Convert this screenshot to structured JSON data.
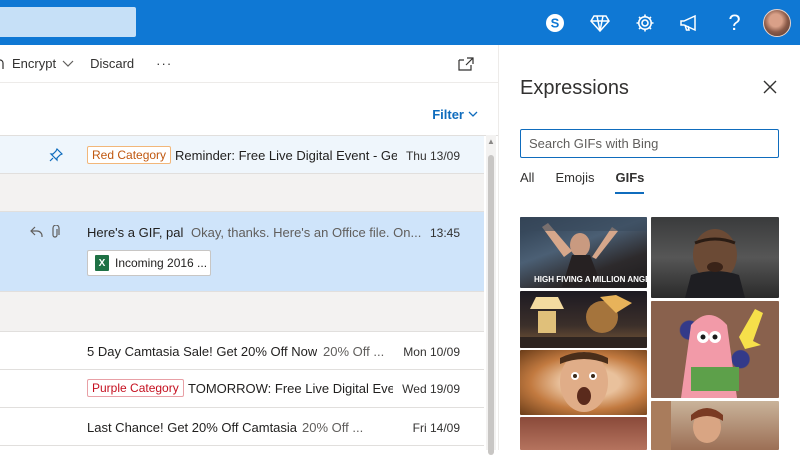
{
  "header": {
    "icons": [
      "skype-icon",
      "diamond-icon",
      "gear-icon",
      "megaphone-icon",
      "help-icon",
      "avatar"
    ],
    "help_label": "?"
  },
  "command_bar": {
    "encrypt_label": "Encrypt",
    "discard_label": "Discard",
    "more_label": "···"
  },
  "filter": {
    "label": "Filter"
  },
  "messages": [
    {
      "category": "Red Category",
      "subject": "Reminder: Free Live Digital Event - Get",
      "preview": "",
      "date": "Thu 13/09",
      "pinned": true
    },
    {
      "category": "",
      "subject": "Here's a GIF, pal",
      "preview": "Okay, thanks. Here's an Office file. On...",
      "date": "13:45",
      "attachment": "Incoming 2016 ...",
      "attachment_icon": "X"
    },
    {
      "category": "",
      "subject": "5 Day Camtasia Sale! Get 20% Off Now",
      "preview": "20% Off ...",
      "date": "Mon 10/09"
    },
    {
      "category": "Purple Category",
      "subject": "TOMORROW: Free Live Digital Even",
      "preview": "",
      "date": "Wed 19/09"
    },
    {
      "category": "",
      "subject": "Last Chance! Get 20% Off Camtasia",
      "preview": "20% Off ...",
      "date": "Fri 14/09"
    }
  ],
  "expressions": {
    "title": "Expressions",
    "search_placeholder": "Search GIFs with Bing",
    "tabs": [
      "All",
      "Emojis",
      "GIFs"
    ],
    "active_tab": "GIFs",
    "gif_caption_1": "HIGH FIVING A MILLION ANGELS"
  },
  "colors": {
    "brand": "#0f78d4",
    "selected_row": "#cfe4fa",
    "accent": "#0f6cbd"
  }
}
